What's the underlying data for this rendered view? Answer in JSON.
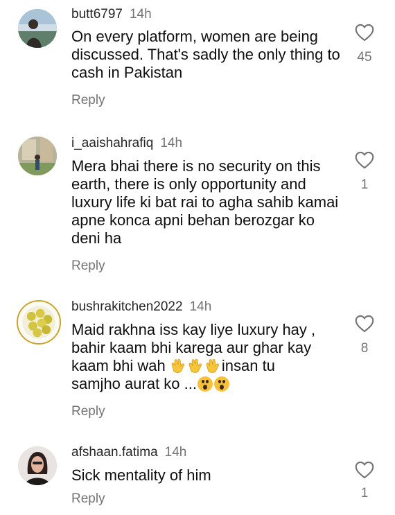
{
  "comments": [
    {
      "username": "butt6797",
      "time": "14h",
      "text": "On every platform, women are being discussed. That's sadly the only thing to cash in Pakistan",
      "reply_label": "Reply",
      "likes": "45"
    },
    {
      "username": "i_aaishahrafiq",
      "time": "14h",
      "text": "Mera bhai there is no security on this earth, there is only opportunity and luxury life ki bat rai to agha sahib kamai apne konca apni behan berozgar ko deni ha",
      "reply_label": "Reply",
      "likes": "1"
    },
    {
      "username": "bushrakitchen2022",
      "time": "14h",
      "text_line1": "Maid rakhna iss kay liye luxury hay ,",
      "text_line2": "bahir kaam bhi karega aur ghar kay",
      "text_line3a": "kaam bhi wah ",
      "text_line3b": "insan tu",
      "text_line4": "samjho aurat ko ...",
      "reply_label": "Reply",
      "likes": "8"
    },
    {
      "username": "afshaan.fatima",
      "time": "14h",
      "text": "Sick mentality of him",
      "reply_label": "Reply",
      "likes": "1"
    }
  ],
  "icons": {
    "like": "heart-outline-icon",
    "clap": "clapping-hands-emoji",
    "wow": "astonished-face-emoji"
  },
  "colors": {
    "secondary_text": "#737373",
    "primary_text": "#0f0f0f"
  }
}
